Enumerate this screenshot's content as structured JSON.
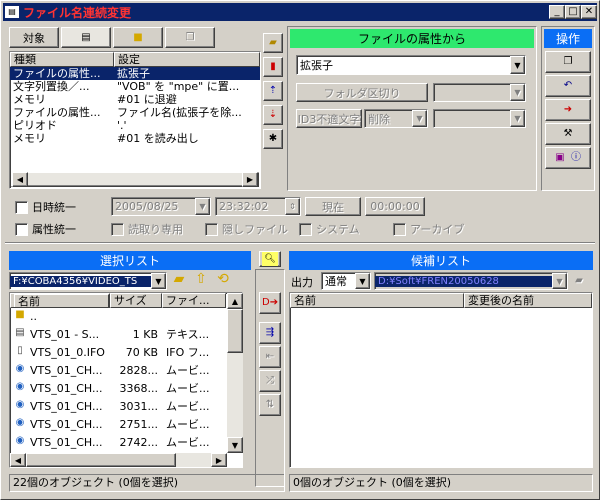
{
  "window": {
    "title": "ファイル名連続変更",
    "min": "_",
    "max": "□",
    "close": "✕"
  },
  "target_tab": {
    "label": "対象"
  },
  "rules": {
    "columns": [
      "種類",
      "設定"
    ],
    "rows": [
      {
        "kind": "ファイルの属性...",
        "setting": "拡張子"
      },
      {
        "kind": "文字列置換／...",
        "setting": "\"VOB\" を \"mpe\" に置..."
      },
      {
        "kind": "メモリ",
        "setting": "#01 に退避"
      },
      {
        "kind": "ファイルの属性...",
        "setting": "ファイル名(拡張子を除..."
      },
      {
        "kind": "ピリオド",
        "setting": "'.'"
      },
      {
        "kind": "メモリ",
        "setting": "#01 を読み出し"
      }
    ]
  },
  "attr_panel": {
    "header": "ファイルの属性から",
    "select_value": "拡張子",
    "folder_sep_label": "フォルダ区切り",
    "id3_label": "ID3不適文字",
    "id3_action": "削除"
  },
  "op_panel": {
    "header": "操作"
  },
  "datetime": {
    "label": "日時統一",
    "date": "2005/08/25",
    "time": "23:32:02",
    "now_btn": "現在",
    "zero_btn": "00:00:00"
  },
  "attrib": {
    "label": "属性統一",
    "readonly": "読取り専用",
    "hidden": "隠しファイル",
    "system": "システム",
    "archive": "アーカイブ"
  },
  "select_list": {
    "header": "選択リスト",
    "path": "F:¥COBA4356¥VIDEO_TS",
    "columns": [
      "名前",
      "サイズ",
      "ファイ..."
    ],
    "sort_icon": "▲",
    "files": [
      {
        "name": "..",
        "size": "",
        "type": "",
        "icon": "folder-icon"
      },
      {
        "name": "VTS_01 - S...",
        "size": "1 KB",
        "type": "テキス...",
        "icon": "text-file-icon"
      },
      {
        "name": "VTS_01_0.IFO",
        "size": "70 KB",
        "type": "IFO フ...",
        "icon": "file-icon"
      },
      {
        "name": "VTS_01_CH...",
        "size": "2828...",
        "type": "ムービ...",
        "icon": "movie-icon"
      },
      {
        "name": "VTS_01_CH...",
        "size": "3368...",
        "type": "ムービ...",
        "icon": "movie-icon"
      },
      {
        "name": "VTS_01_CH...",
        "size": "3031...",
        "type": "ムービ...",
        "icon": "movie-icon"
      },
      {
        "name": "VTS_01_CH...",
        "size": "2751...",
        "type": "ムービ...",
        "icon": "movie-icon"
      },
      {
        "name": "VTS_01_CH...",
        "size": "2742...",
        "type": "ムービ...",
        "icon": "movie-icon"
      }
    ],
    "status": "22個のオブジェクト (0個を選択)"
  },
  "candidate_list": {
    "header": "候補リスト",
    "output_label": "出力",
    "output_mode": "通常",
    "output_path": "D:¥Soft¥FREN20050628",
    "columns": [
      "名前",
      "変更後の名前"
    ],
    "status": "0個のオブジェクト (0個を選択)"
  }
}
